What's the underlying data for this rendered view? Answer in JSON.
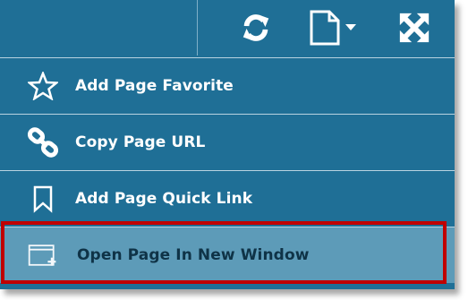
{
  "toolbar": {
    "buttons": [
      {
        "name": "refresh-icon"
      },
      {
        "name": "page-options-icon"
      },
      {
        "name": "expand-icon"
      }
    ]
  },
  "menu": {
    "items": [
      {
        "label": "Add Page Favorite",
        "icon": "star-icon"
      },
      {
        "label": "Copy Page URL",
        "icon": "link-icon"
      },
      {
        "label": "Add Page Quick Link",
        "icon": "bookmark-icon"
      },
      {
        "label": "Open Page In New Window",
        "icon": "new-window-icon",
        "highlighted": true
      }
    ]
  },
  "colors": {
    "menu_bg": "#1f6f96",
    "highlight_bg": "#5d9bb8",
    "separator": "#b9d3e1",
    "callout_border": "#c00000"
  }
}
